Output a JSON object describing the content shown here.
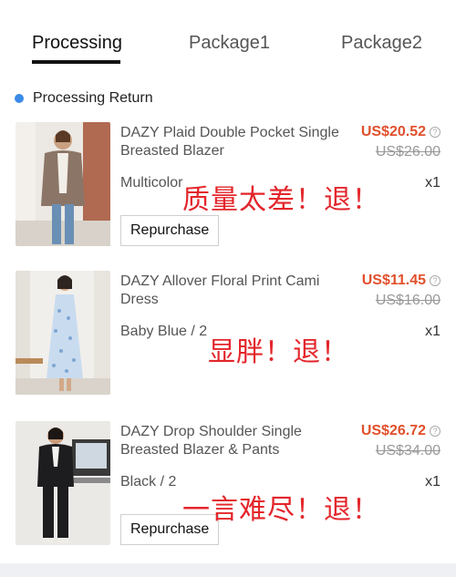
{
  "tabs": [
    {
      "label": "Processing",
      "active": true
    },
    {
      "label": "Package1",
      "active": false
    },
    {
      "label": "Package2",
      "active": false
    }
  ],
  "status": {
    "label": "Processing Return",
    "color": "#3b8be8"
  },
  "items": [
    {
      "name": "DAZY Plaid Double Pocket Single Breasted Blazer",
      "price": "US$20.52",
      "original_price": "US$26.00",
      "variant": "Multicolor",
      "quantity": "x1",
      "button": "Repurchase",
      "overlay": "质量太差！退！"
    },
    {
      "name": "DAZY Allover Floral Print Cami Dress",
      "price": "US$11.45",
      "original_price": "US$16.00",
      "variant": "Baby Blue / 2",
      "quantity": "x1",
      "overlay": "显胖！退！"
    },
    {
      "name": "DAZY Drop Shoulder Single Breasted Blazer & Pants",
      "price": "US$26.72",
      "original_price": "US$34.00",
      "variant": "Black / 2",
      "quantity": "x1",
      "button": "Repurchase",
      "overlay": "一言难尽！退！"
    }
  ],
  "colors": {
    "price": "#e0502c",
    "overlay": "#e3262b",
    "tab_active": "#111111"
  }
}
